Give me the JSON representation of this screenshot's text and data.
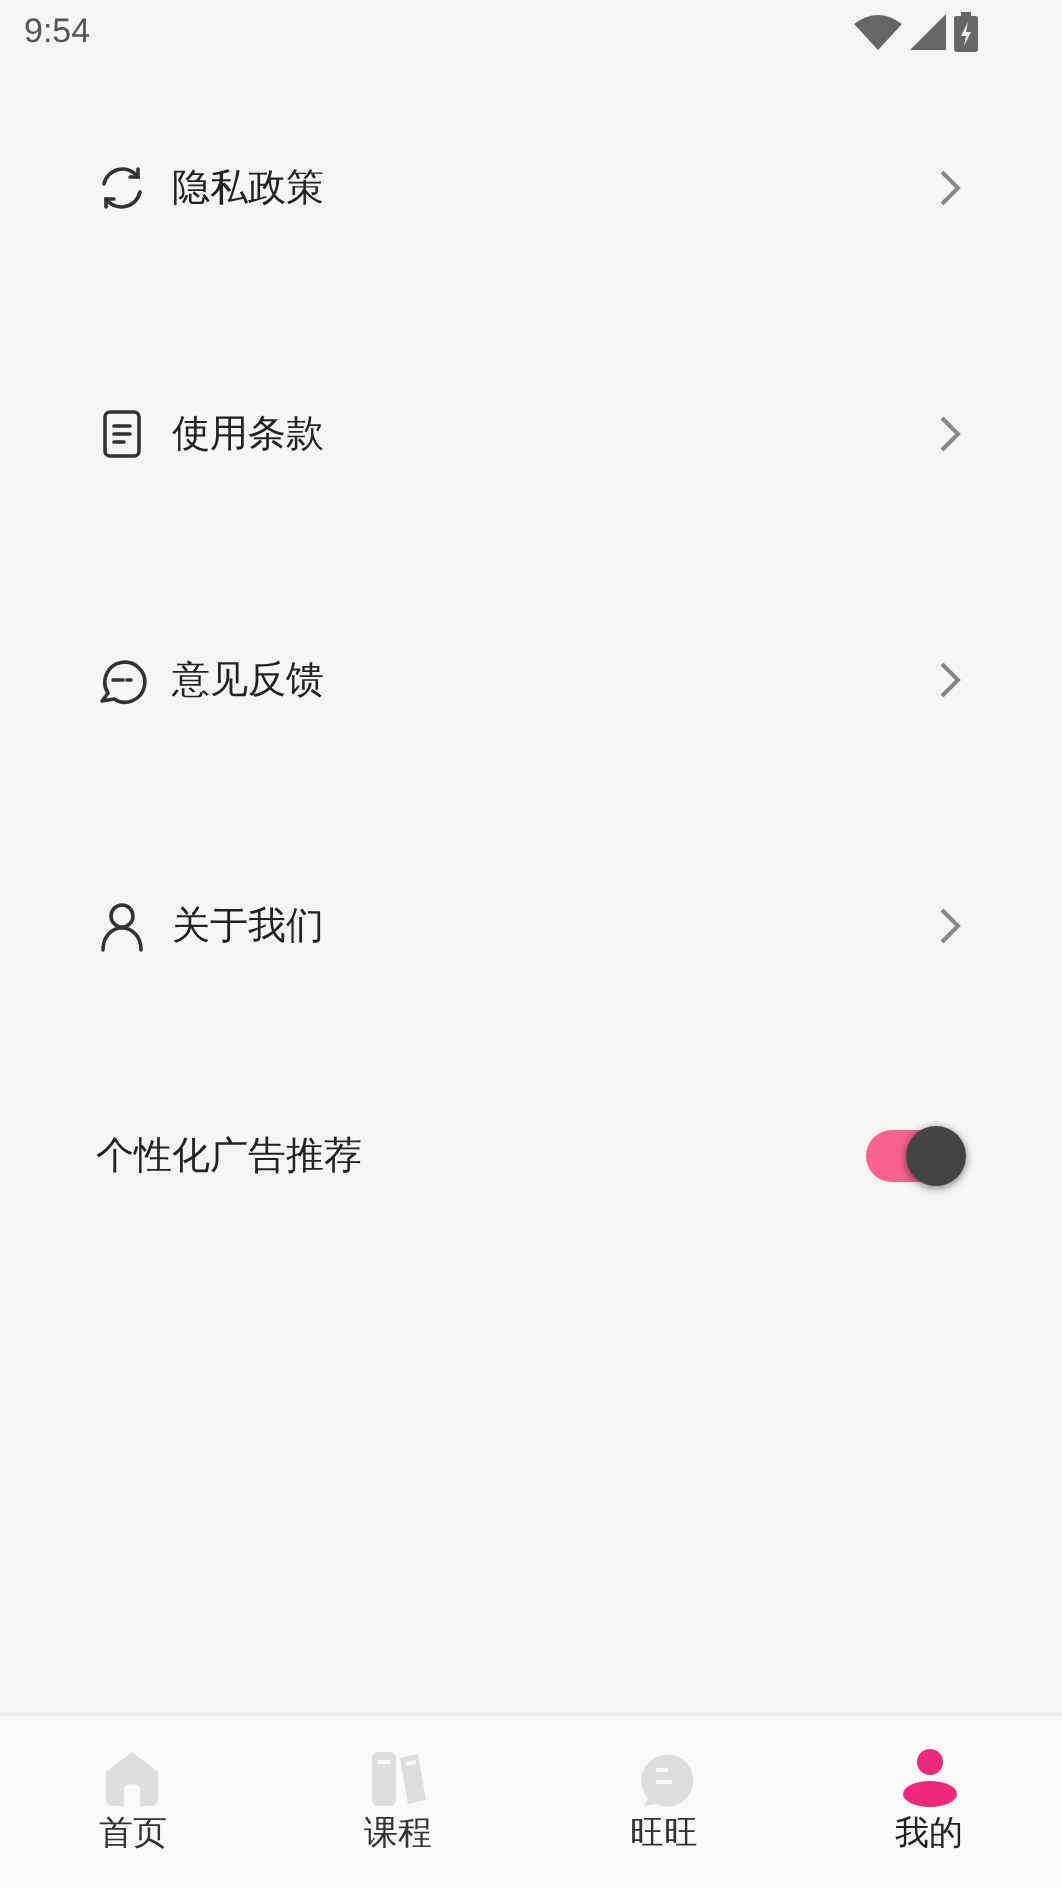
{
  "status_bar": {
    "time": "9:54"
  },
  "menu": [
    {
      "label": "隐私政策"
    },
    {
      "label": "使用条款"
    },
    {
      "label": "意见反馈"
    },
    {
      "label": "关于我们"
    }
  ],
  "ad_setting": {
    "label": "个性化广告推荐",
    "on": true
  },
  "bottom_nav": [
    {
      "label": "首页",
      "selected": false
    },
    {
      "label": "课程",
      "selected": false
    },
    {
      "label": "旺旺",
      "selected": false
    },
    {
      "label": "我的",
      "selected": true
    }
  ]
}
